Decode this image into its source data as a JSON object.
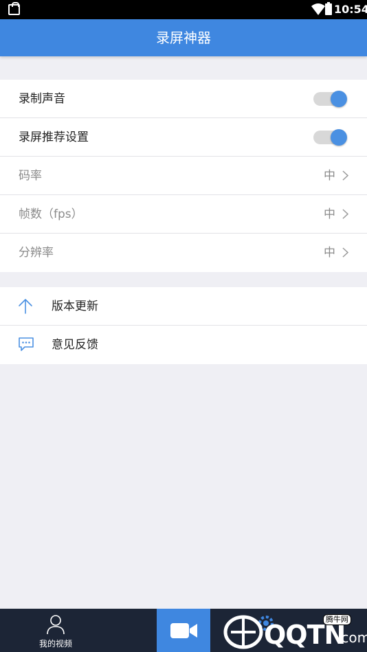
{
  "status_bar": {
    "time": "10:54"
  },
  "app_bar": {
    "title": "录屏神器"
  },
  "settings": {
    "record_audio": {
      "label": "录制声音",
      "enabled": true
    },
    "recommended": {
      "label": "录屏推荐设置",
      "enabled": true
    },
    "bitrate": {
      "label": "码率",
      "value": "中"
    },
    "fps": {
      "label": "帧数（fps）",
      "value": "中"
    },
    "resolution": {
      "label": "分辨率",
      "value": "中"
    }
  },
  "misc": {
    "update": {
      "label": "版本更新",
      "icon": "upload-arrow-icon"
    },
    "feedback": {
      "label": "意见反馈",
      "icon": "chat-bubble-icon"
    }
  },
  "tab_bar": {
    "videos_label": "我的视频",
    "active_tab": "record"
  },
  "watermark": {
    "brand": "QQTN",
    "suffix": ".com",
    "badge": "腾牛网"
  },
  "colors": {
    "accent": "#3f87e0",
    "toggle_knob": "#4a90e2",
    "tab_bar_bg": "#1c2536",
    "page_bg": "#efeff4"
  }
}
